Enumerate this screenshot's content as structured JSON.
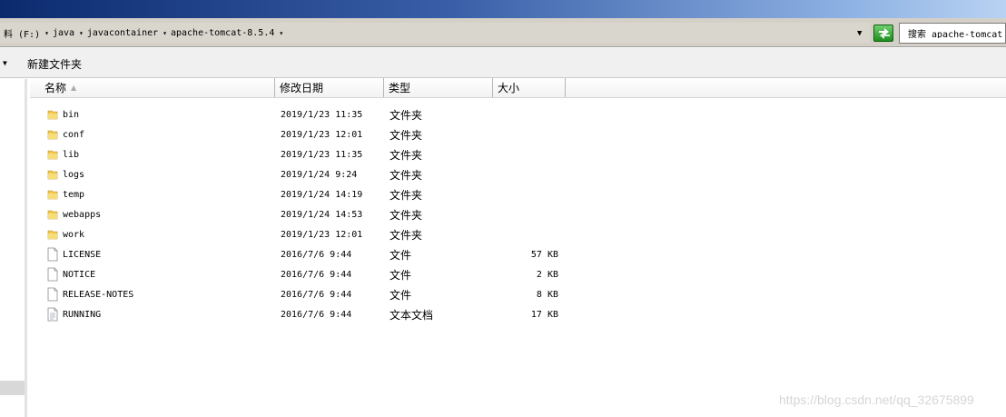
{
  "address": {
    "crumbs": [
      "料 (F:)",
      "java",
      "javacontainer",
      "apache-tomcat-8.5.4"
    ],
    "search_value": "搜索 apache-tomcat"
  },
  "toolbar": {
    "new_folder_label": "新建文件夹"
  },
  "columns": {
    "name": "名称",
    "date": "修改日期",
    "type": "类型",
    "size": "大小"
  },
  "files": [
    {
      "name": "bin",
      "date": "2019/1/23 11:35",
      "type": "文件夹",
      "size": "",
      "icon": "folder-icon"
    },
    {
      "name": "conf",
      "date": "2019/1/23 12:01",
      "type": "文件夹",
      "size": "",
      "icon": "folder-icon"
    },
    {
      "name": "lib",
      "date": "2019/1/23 11:35",
      "type": "文件夹",
      "size": "",
      "icon": "folder-icon"
    },
    {
      "name": "logs",
      "date": "2019/1/24 9:24",
      "type": "文件夹",
      "size": "",
      "icon": "folder-icon"
    },
    {
      "name": "temp",
      "date": "2019/1/24 14:19",
      "type": "文件夹",
      "size": "",
      "icon": "folder-icon"
    },
    {
      "name": "webapps",
      "date": "2019/1/24 14:53",
      "type": "文件夹",
      "size": "",
      "icon": "folder-icon"
    },
    {
      "name": "work",
      "date": "2019/1/23 12:01",
      "type": "文件夹",
      "size": "",
      "icon": "folder-icon"
    },
    {
      "name": "LICENSE",
      "date": "2016/7/6 9:44",
      "type": "文件",
      "size": "57 KB",
      "icon": "file-icon"
    },
    {
      "name": "NOTICE",
      "date": "2016/7/6 9:44",
      "type": "文件",
      "size": "2 KB",
      "icon": "file-icon"
    },
    {
      "name": "RELEASE-NOTES",
      "date": "2016/7/6 9:44",
      "type": "文件",
      "size": "8 KB",
      "icon": "file-icon"
    },
    {
      "name": "RUNNING",
      "date": "2016/7/6 9:44",
      "type": "文本文档",
      "size": "17 KB",
      "icon": "text-document-icon"
    }
  ],
  "watermark": "https://blog.csdn.net/qq_32675899",
  "colors": {
    "folder": "#f2c94c",
    "titlebar_start": "#0b2a6e",
    "titlebar_end": "#b9d2f2"
  }
}
